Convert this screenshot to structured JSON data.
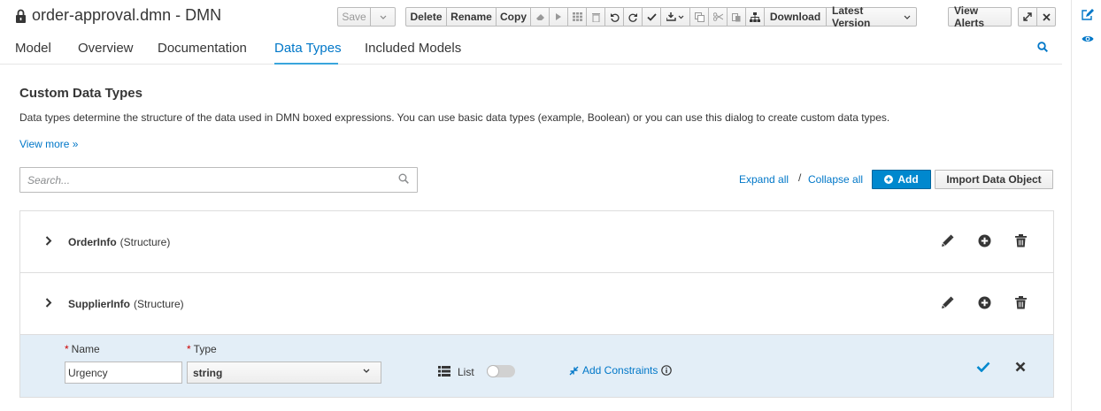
{
  "window": {
    "title": "order-approval.dmn - DMN"
  },
  "toolbar": {
    "save": "Save",
    "delete": "Delete",
    "rename": "Rename",
    "copy": "Copy",
    "download": "Download",
    "latest_version": "Latest Version",
    "view_alerts": "View Alerts"
  },
  "tabs": [
    "Model",
    "Overview",
    "Documentation",
    "Data Types",
    "Included Models"
  ],
  "active_tab": "Data Types",
  "content": {
    "section_title": "Custom Data Types",
    "description": "Data types determine the structure of the data used in DMN boxed expressions. You can use basic data types (example, Boolean) or you can use this dialog to create custom data types.",
    "view_more": "View more »",
    "search_placeholder": "Search...",
    "expand_all": "Expand all",
    "separator": "/",
    "collapse_all": "Collapse all",
    "add": "Add",
    "import": "Import Data Object"
  },
  "data_types": [
    {
      "name": "OrderInfo",
      "kind": "(Structure)"
    },
    {
      "name": "SupplierInfo",
      "kind": "(Structure)"
    }
  ],
  "editor": {
    "name_label": "Name",
    "type_label": "Type",
    "required_mark": "*",
    "name_value": "Urgency",
    "type_value": "string",
    "list_label": "List",
    "list_enabled": false,
    "add_constraints": "Add Constraints"
  },
  "colors": {
    "accent": "#0077c8",
    "primary_button": "#0088ce",
    "editor_row": "#e3eef7"
  }
}
